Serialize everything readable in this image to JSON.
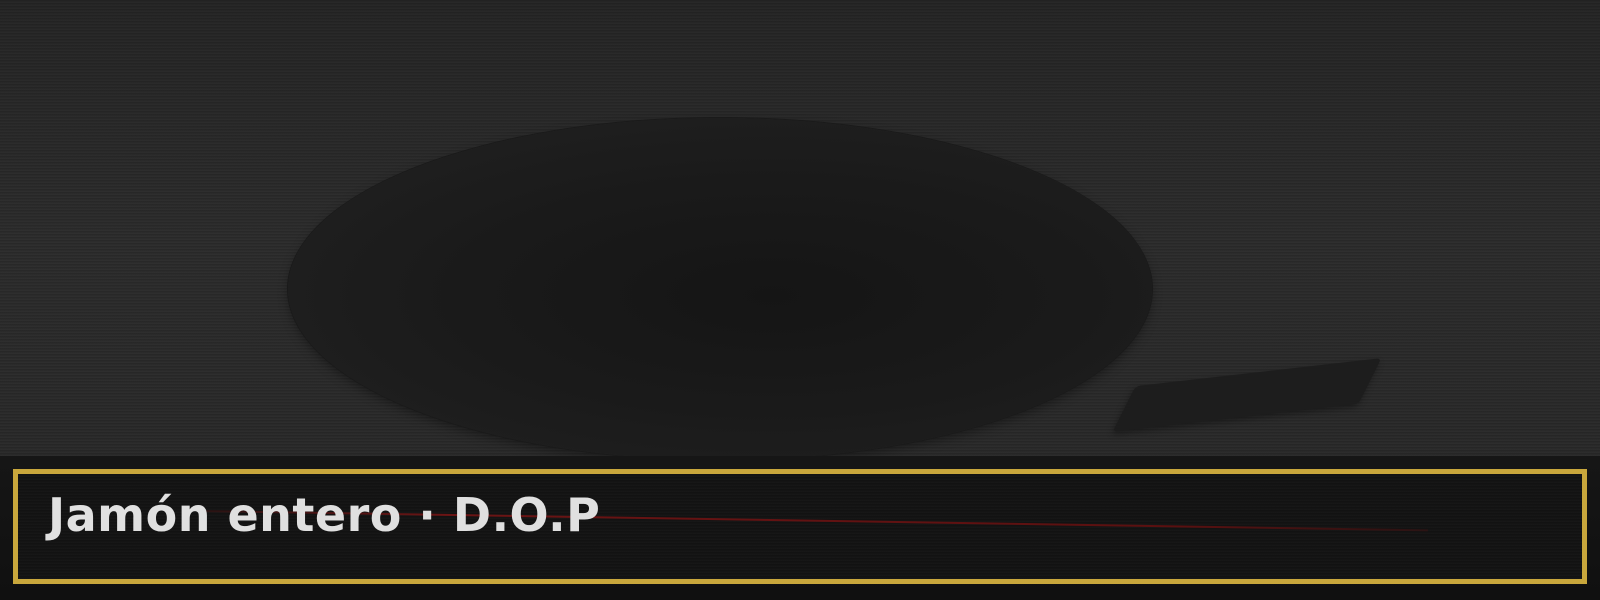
{
  "caption": {
    "title": "Jamón entero · D.O.P"
  },
  "colors": {
    "frame_border": "#c9a73c",
    "accent_line": "#6b1414",
    "title_text": "#e0e0e0",
    "background": "#262626"
  }
}
